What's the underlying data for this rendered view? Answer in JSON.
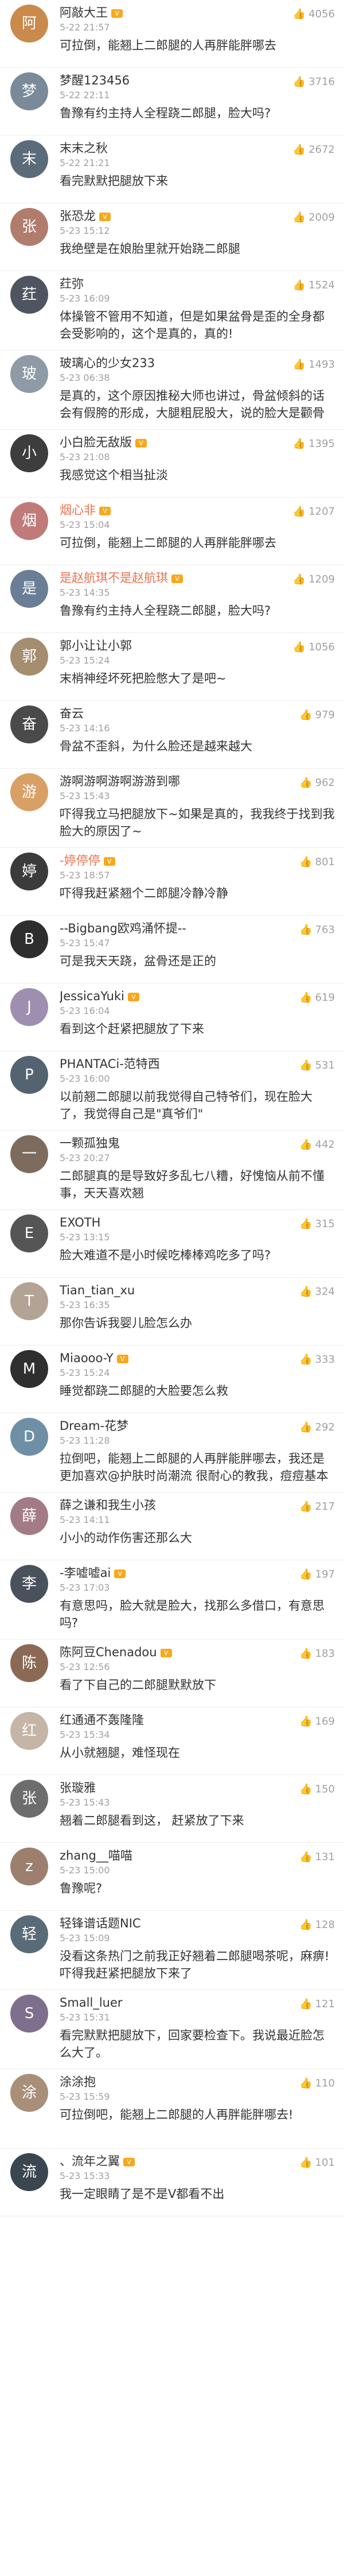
{
  "comments": [
    {
      "user": "阿敲大王",
      "badge": true,
      "time": "5-22 21:57",
      "likes": "4056",
      "text": "可拉倒，能翘上二郎腿的人再胖能胖哪去",
      "avatar_color": "#c98a4b",
      "tall": false,
      "user_red": false
    },
    {
      "user": "梦醒123456",
      "badge": false,
      "time": "5-22 22:11",
      "likes": "3716",
      "text": "鲁豫有约主持人全程跷二郎腿，脸大吗?",
      "avatar_color": "#7a8a99",
      "tall": false,
      "user_red": false
    },
    {
      "user": "末末之秋",
      "badge": false,
      "time": "5-22 21:21",
      "likes": "2672",
      "text": "看完默默把腿放下来",
      "avatar_color": "#5c6b7a",
      "tall": false,
      "user_red": false
    },
    {
      "user": "张恐龙",
      "badge": true,
      "time": "5-23 15:12",
      "likes": "2009",
      "text": "我绝壁是在娘胎里就开始跷二郎腿",
      "avatar_color": "#b07c6e",
      "tall": false,
      "user_red": false
    },
    {
      "user": "荭弥",
      "badge": false,
      "time": "5-23 16:09",
      "likes": "1524",
      "text": "体操管不管用不知道，但是如果盆骨是歪的全身都会受影响的，这个是真的，真的!",
      "avatar_color": "#4f5560",
      "tall": true,
      "user_red": false
    },
    {
      "user": "玻璃心的少女233",
      "badge": false,
      "time": "5-23 06:38",
      "likes": "1493",
      "text": "是真的，这个原因推秘大师也讲过，骨盆倾斜的话会有假胯的形成，大腿粗屁股大，说的脸大是颧骨变大了。",
      "avatar_color": "#8e9aa6",
      "tall": true,
      "user_red": false
    },
    {
      "user": "小白脸无敌版",
      "badge": true,
      "time": "5-23 21:08",
      "likes": "1395",
      "text": "我感觉这个相当扯淡",
      "avatar_color": "#3d3d3d",
      "tall": false,
      "user_red": false
    },
    {
      "user": "烟心非",
      "badge": true,
      "time": "5-23 15:04",
      "likes": "1207",
      "text": "可拉倒，能翘上二郎腿的人再胖能胖哪去",
      "avatar_color": "#c07a7a",
      "tall": false,
      "user_red": true
    },
    {
      "user": "是赵航琪不是赵航琪",
      "badge": true,
      "time": "5-23 14:35",
      "likes": "1209",
      "text": "鲁豫有约主持人全程跷二郎腿，脸大吗?",
      "avatar_color": "#6a7f95",
      "tall": false,
      "user_red": true
    },
    {
      "user": "郭小让让小郭",
      "badge": false,
      "time": "5-23 15:24",
      "likes": "1056",
      "text": "末梢神经坏死把脸憋大了是吧~",
      "avatar_color": "#a58d6f",
      "tall": false,
      "user_red": false
    },
    {
      "user": "奋云",
      "badge": false,
      "time": "5-23 14:16",
      "likes": "979",
      "text": "骨盆不歪斜，为什么脸还是越来越大",
      "avatar_color": "#4a4a4a",
      "tall": false,
      "user_red": false
    },
    {
      "user": "游啊游啊游啊游游到哪",
      "badge": false,
      "time": "5-23 15:43",
      "likes": "962",
      "text": "吓得我立马把腿放下~如果是真的，我我终于找到我脸大的原因了~",
      "avatar_color": "#d9a066",
      "tall": true,
      "user_red": false
    },
    {
      "user": "-婷停停",
      "badge": true,
      "time": "5-23 18:57",
      "likes": "801",
      "text": "吓得我赶紧翘个二郎腿冷静冷静",
      "avatar_color": "#3b3b3b",
      "tall": false,
      "user_red": true
    },
    {
      "user": "--Bigbang欧鸡涌怀提--",
      "badge": false,
      "time": "5-23 15:47",
      "likes": "763",
      "text": "可是我天天跷，盆骨还是正的",
      "avatar_color": "#2e2e2e",
      "tall": false,
      "user_red": false
    },
    {
      "user": "JessicaYuki",
      "badge": true,
      "time": "5-23 16:04",
      "likes": "619",
      "text": "看到这个赶紧把腿放了下来",
      "avatar_color": "#9e8fb0",
      "tall": false,
      "user_red": false
    },
    {
      "user": "PHANTACi-范特西",
      "badge": false,
      "time": "5-23 16:00",
      "likes": "531",
      "text": "以前翘二郎腿以前我觉得自己特爷们，现在脸大了，我觉得自己是\"真爷们\"",
      "avatar_color": "#556270",
      "tall": true,
      "user_red": false
    },
    {
      "user": "一颗孤独鬼",
      "badge": false,
      "time": "5-23 20:27",
      "likes": "442",
      "text": "二郎腿真的是导致好多乱七八糟，好愧恼从前不懂事，天天喜欢翘",
      "avatar_color": "#7d6b5d",
      "tall": true,
      "user_red": false
    },
    {
      "user": "EXOTH",
      "badge": false,
      "time": "5-23 13:15",
      "likes": "315",
      "text": "脸大难道不是小时候吃棒棒鸡吃多了吗?",
      "avatar_color": "#555555",
      "tall": false,
      "user_red": false
    },
    {
      "user": "Tian_tian_xu",
      "badge": false,
      "time": "5-23 16:35",
      "likes": "324",
      "text": "那你告诉我婴儿脸怎么办",
      "avatar_color": "#b3a394",
      "tall": false,
      "user_red": false
    },
    {
      "user": "Miaooo-Y",
      "badge": true,
      "time": "5-23 15:24",
      "likes": "333",
      "text": "睡觉都跷二郎腿的大脸要怎么救",
      "avatar_color": "#2f2f2f",
      "tall": false,
      "user_red": false
    },
    {
      "user": "Dream-花梦",
      "badge": false,
      "time": "5-23 11:28",
      "likes": "292",
      "text": "拉倒吧，能翘上二郎腿的人再胖能胖哪去，我还是更加喜欢@护肤时尚潮流 很耐心的教我，痘痘基本上不见了",
      "avatar_color": "#6f8fa6",
      "tall": true,
      "user_red": false
    },
    {
      "user": "薛之谦和我生小孩",
      "badge": false,
      "time": "5-23 14:11",
      "likes": "217",
      "text": "小小的动作伤害还那么大",
      "avatar_color": "#a37b86",
      "tall": false,
      "user_red": false
    },
    {
      "user": "-李嘘嘘ai",
      "badge": true,
      "time": "5-23 17:03",
      "likes": "197",
      "text": "有意思吗，脸大就是脸大，找那么多借口，有意思吗?",
      "avatar_color": "#49525c",
      "tall": true,
      "user_red": false
    },
    {
      "user": "陈阿豆Chenadou",
      "badge": true,
      "time": "5-23 12:56",
      "likes": "183",
      "text": "看了下自己的二郎腿默默放下",
      "avatar_color": "#8b6a55",
      "tall": false,
      "user_red": false
    },
    {
      "user": "红通通不轰隆隆",
      "badge": false,
      "time": "5-23 15:34",
      "likes": "169",
      "text": "从小就翘腿，难怪现在",
      "avatar_color": "#c4b5a6",
      "tall": false,
      "user_red": false
    },
    {
      "user": "张璇雅",
      "badge": false,
      "time": "5-23 15:43",
      "likes": "150",
      "text": "翘着二郎腿看到这， 赶紧放了下来",
      "avatar_color": "#6d6d6d",
      "tall": false,
      "user_red": false
    },
    {
      "user": "zhang__喵喵",
      "badge": false,
      "time": "5-23 15:00",
      "likes": "131",
      "text": "鲁豫呢?",
      "avatar_color": "#9c7f6e",
      "tall": false,
      "user_red": false
    },
    {
      "user": "轻锋谱话题NIC",
      "badge": false,
      "time": "5-23 15:09",
      "likes": "128",
      "text": "没看这条热门之前我正好翘着二郎腿喝茶呢，麻痹! 吓得我赶紧把腿放下来了",
      "avatar_color": "#5a6b78",
      "tall": true,
      "user_red": false
    },
    {
      "user": "Small_luer",
      "badge": false,
      "time": "5-23 15:31",
      "likes": "121",
      "text": "看完默默把腿放下，回家要检查下。我说最近脸怎么大了。",
      "avatar_color": "#7e6f8c",
      "tall": true,
      "user_red": false
    },
    {
      "user": "涂涂抱",
      "badge": false,
      "time": "5-23 15:59",
      "likes": "110",
      "text": "可拉倒吧，能翘上二郎腿的人再胖能胖哪去!",
      "avatar_color": "#a88f7a",
      "tall": true,
      "user_red": false
    },
    {
      "user": "、流年之翼",
      "badge": true,
      "time": "5-23 15:33",
      "likes": "101",
      "text": "我一定眼睛了是不是V都看不出",
      "avatar_color": "#3c4650",
      "tall": false,
      "user_red": false
    }
  ],
  "icons": {
    "like": "thumbs-up-icon",
    "emoji": "smiley-emoji-icon"
  }
}
